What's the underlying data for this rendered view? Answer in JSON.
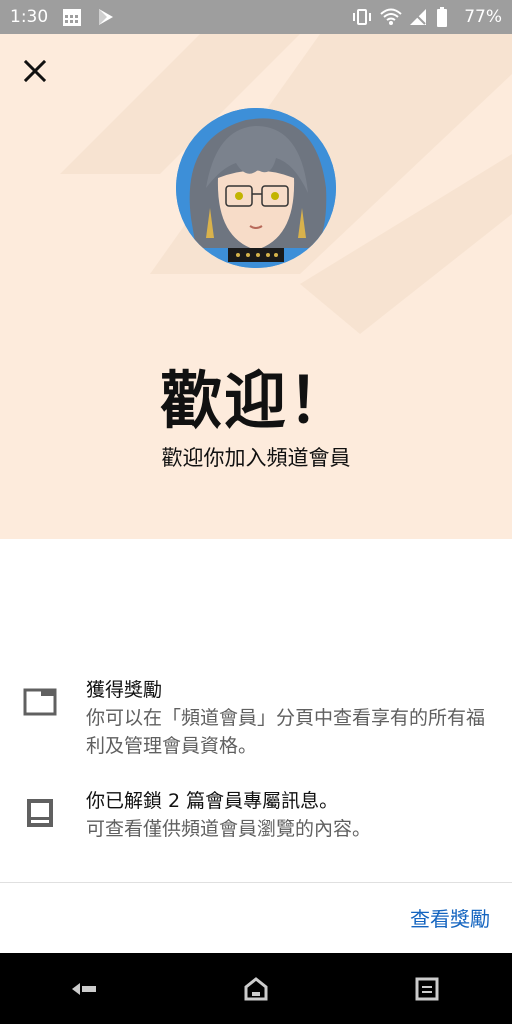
{
  "status_bar": {
    "time": "1:30",
    "battery": "77%",
    "icons_left": [
      "calendar-icon",
      "play-store-icon"
    ],
    "icons_right": [
      "vibrate-icon",
      "wifi-icon",
      "no-signal-icon",
      "battery-icon"
    ]
  },
  "header": {
    "close_icon": "close-icon",
    "title": "歡迎！",
    "subtitle": "歡迎你加入頻道會員"
  },
  "benefits": [
    {
      "icon": "window-icon",
      "title": "獲得獎勵",
      "description": "你可以在「頻道會員」分頁中查看享有的所有福利及管理會員資格。"
    },
    {
      "icon": "message-icon",
      "title": "你已解鎖 2 篇會員專屬訊息。",
      "description": "可查看僅供頻道會員瀏覽的內容。"
    }
  ],
  "action": {
    "label": "查看獎勵",
    "color": "#1565c0"
  },
  "colors": {
    "hero_background": "#fdebdc",
    "status_bar": "#9e9e9e",
    "nav_bar": "#000000"
  },
  "nav_bar": {
    "icons": [
      "back-icon",
      "home-icon",
      "recents-icon"
    ]
  }
}
